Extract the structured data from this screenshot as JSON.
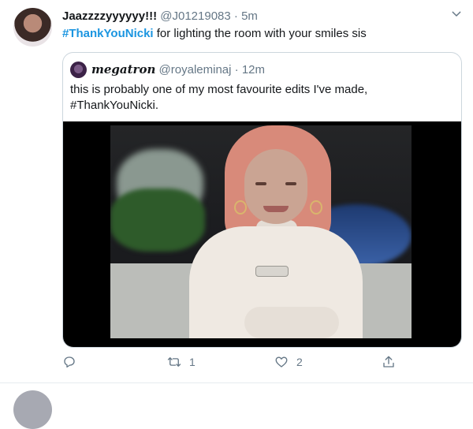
{
  "tweet": {
    "display_name": "Jaazzzzyyyyyy!!!",
    "handle": "@J01219083",
    "separator": "·",
    "time": "5m",
    "hashtag": "#ThankYouNicki",
    "text_rest": " for lighting the room with your smiles sis"
  },
  "quote": {
    "display_name": "megatron",
    "handle": "@royaleminaj",
    "separator": "·",
    "time": "12m",
    "text_line1": "this is probably one of my most favourite edits I've made,",
    "text_line2": "#ThankYouNicki."
  },
  "actions": {
    "reply_count": "",
    "retweet_count": "1",
    "like_count": "2"
  },
  "colors": {
    "link": "#1b95e0",
    "muted": "#657786",
    "border": "#ccd6dd"
  },
  "icons": [
    "chevron-down-icon",
    "reply-icon",
    "retweet-icon",
    "like-icon",
    "share-icon"
  ]
}
